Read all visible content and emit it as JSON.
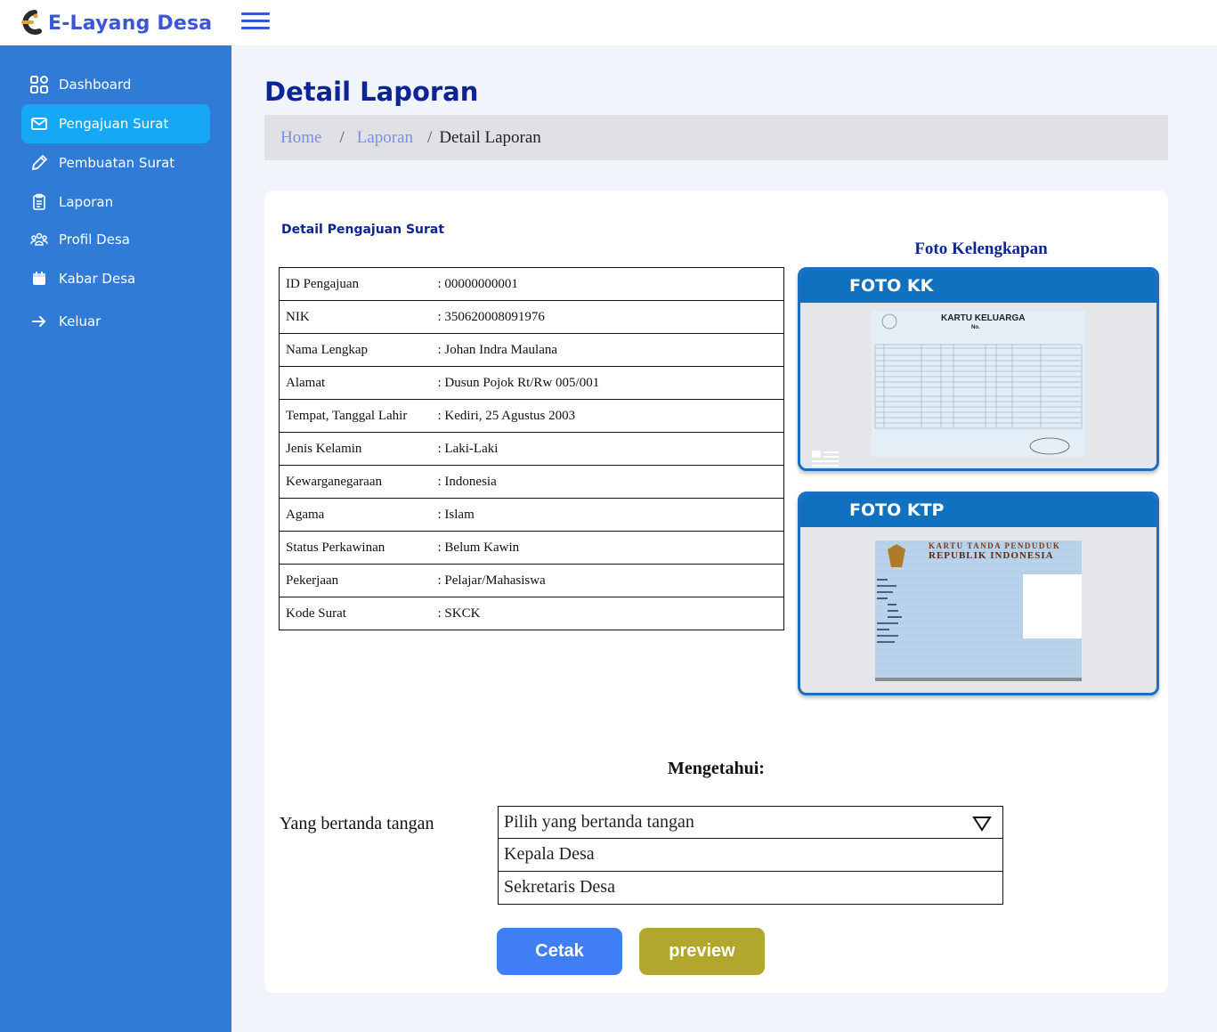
{
  "app": {
    "title": "E-Layang Desa"
  },
  "sidebar": {
    "items": [
      {
        "label": "Dashboard",
        "icon": "dashboard-icon",
        "active": false
      },
      {
        "label": "Pengajuan Surat",
        "icon": "mail-icon",
        "active": true
      },
      {
        "label": "Pembuatan Surat",
        "icon": "pencil-icon",
        "active": false
      },
      {
        "label": "Laporan",
        "icon": "clipboard-icon",
        "active": false
      },
      {
        "label": "Profil Desa",
        "icon": "people-icon",
        "active": false
      },
      {
        "label": "Kabar Desa",
        "icon": "calendar-icon",
        "active": false
      },
      {
        "label": "Keluar",
        "icon": "arrow-right-icon",
        "active": false
      }
    ]
  },
  "page": {
    "title": "Detail Laporan"
  },
  "breadcrumb": {
    "home": "Home",
    "sep": "/",
    "laporan": "Laporan",
    "current": "Detail Laporan"
  },
  "detail": {
    "title": "Detail Pengajuan Surat",
    "rows": [
      {
        "key": "ID Pengajuan",
        "value": ": 00000000001"
      },
      {
        "key": "NIK",
        "value": ": 350620008091976"
      },
      {
        "key": "Nama Lengkap",
        "value": ": Johan Indra Maulana"
      },
      {
        "key": "Alamat",
        "value": ": Dusun Pojok Rt/Rw 005/001"
      },
      {
        "key": "Tempat, Tanggal Lahir",
        "value": ": Kediri, 25 Agustus 2003"
      },
      {
        "key": "Jenis Kelamin",
        "value": ": Laki-Laki"
      },
      {
        "key": "Kewarganegaraan",
        "value": ": Indonesia"
      },
      {
        "key": "Agama",
        "value": ": Islam"
      },
      {
        "key": "Status Perkawinan",
        "value": ": Belum Kawin"
      },
      {
        "key": "Pekerjaan",
        "value": ": Pelajar/Mahasiswa"
      },
      {
        "key": "Kode Surat",
        "value": ": SKCK"
      }
    ]
  },
  "foto": {
    "heading": "Foto Kelengkapan",
    "kk": {
      "label": "FOTO KK",
      "doc_title": "KARTU KELUARGA",
      "doc_no": "No."
    },
    "ktp": {
      "label": "FOTO KTP",
      "doc_title_1": "KARTU TANDA PENDUDUK",
      "doc_title_2": "REPUBLIK INDONESIA"
    }
  },
  "sign": {
    "heading": "Mengetahui:",
    "label": "Yang bertanda tangan",
    "placeholder": "Pilih yang bertanda tangan",
    "options": [
      "Kepala Desa",
      "Sekretaris Desa"
    ]
  },
  "buttons": {
    "cetak": "Cetak",
    "preview": "preview"
  },
  "colors": {
    "sidebar": "#2f7bd6",
    "active": "#16a8f5",
    "brand": "#3d56d8",
    "title": "#0d2494",
    "cetak": "#3f7ef5",
    "preview": "#b3a62c"
  }
}
